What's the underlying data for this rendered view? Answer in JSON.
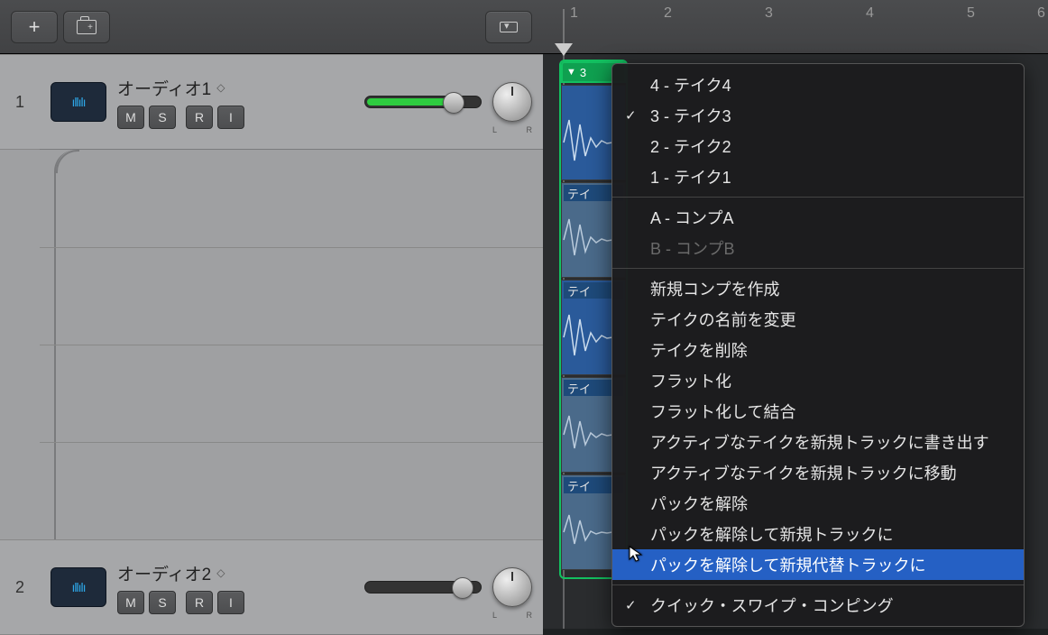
{
  "ruler": {
    "marks": [
      "1",
      "2",
      "3",
      "4",
      "5",
      "6"
    ]
  },
  "tracks": [
    {
      "num": "1",
      "title": "オーディオ1",
      "btns": [
        "M",
        "S",
        "R",
        "I"
      ],
      "vol_fill": 90,
      "vol_knob": 90,
      "pan_l": "L",
      "pan_r": "R"
    },
    {
      "num": "2",
      "title": "オーディオ2",
      "btns": [
        "M",
        "S",
        "R",
        "I"
      ],
      "vol_fill": 0,
      "vol_knob": 98,
      "pan_l": "L",
      "pan_r": "R"
    }
  ],
  "take_header_dd": "▼",
  "take_header_num": "3",
  "take_labels": [
    "テイ",
    "テイ",
    "テイ",
    "テイ"
  ],
  "menu": {
    "takes": [
      {
        "chk": false,
        "label": "4 - テイク4"
      },
      {
        "chk": true,
        "label": "3 - テイク3"
      },
      {
        "chk": false,
        "label": "2 - テイク2"
      },
      {
        "chk": false,
        "label": "1 - テイク1"
      }
    ],
    "comps": [
      {
        "chk": false,
        "label": "A - コンプA",
        "dis": false
      },
      {
        "chk": false,
        "label": "B - コンプB",
        "dis": true
      }
    ],
    "actions": [
      "新規コンプを作成",
      "テイクの名前を変更",
      "テイクを削除",
      "フラット化",
      "フラット化して結合",
      "アクティブなテイクを新規トラックに書き出す",
      "アクティブなテイクを新規トラックに移動",
      "パックを解除",
      "パックを解除して新規トラックに"
    ],
    "highlighted": "パックを解除して新規代替トラックに",
    "footer": {
      "chk": true,
      "label": "クイック・スワイプ・コンピング"
    }
  }
}
